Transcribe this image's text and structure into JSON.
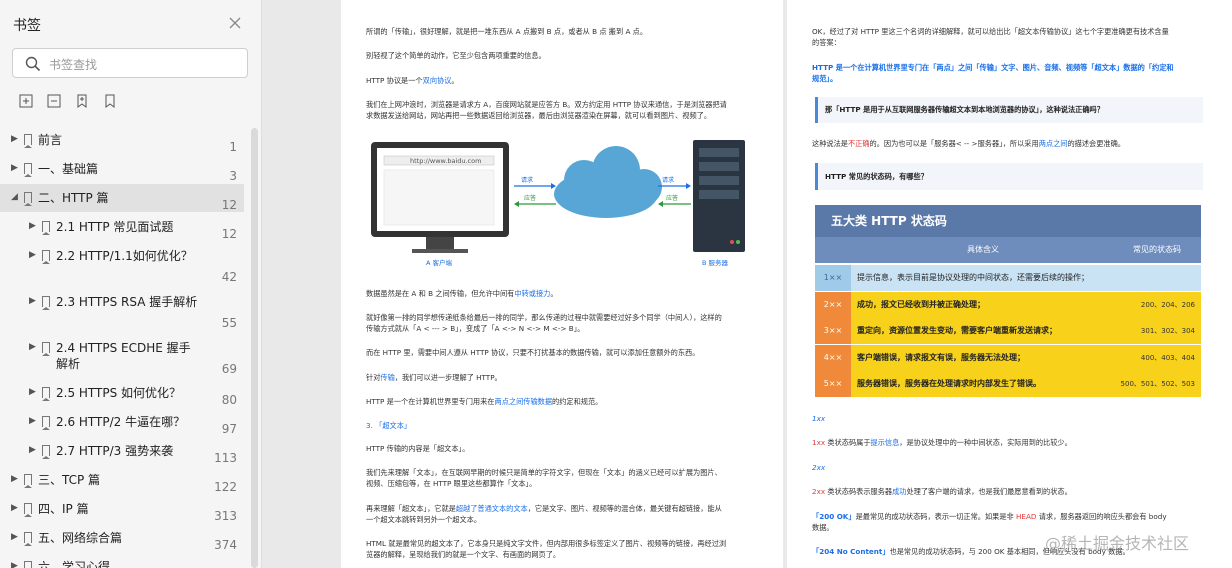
{
  "sidebar": {
    "title": "书签",
    "search_placeholder": "书签查找",
    "toolbar_icons": [
      "expand-all-icon",
      "collapse-all-icon",
      "add-bookmark-icon",
      "bookmark-icon"
    ],
    "items": [
      {
        "label": "前言",
        "page": "1",
        "level": 0,
        "active": false
      },
      {
        "label": "一、基础篇",
        "page": "3",
        "level": 0,
        "active": false
      },
      {
        "label": "二、HTTP 篇",
        "page": "12",
        "level": 0,
        "active": true,
        "expanded": true
      },
      {
        "label": "2.1 HTTP 常见面试题",
        "page": "12",
        "level": 1,
        "active": false
      },
      {
        "label": "2.2 HTTP/1.1如何优化？",
        "page": "42",
        "level": 1,
        "active": false
      },
      {
        "label": "2.3 HTTPS RSA 握手解析",
        "page": "55",
        "level": 1,
        "active": false
      },
      {
        "label": "2.4 HTTPS ECDHE 握手解析",
        "page": "69",
        "level": 1,
        "active": false
      },
      {
        "label": "2.5 HTTPS 如何优化？",
        "page": "80",
        "level": 1,
        "active": false
      },
      {
        "label": "2.6 HTTP/2 牛逼在哪？",
        "page": "97",
        "level": 1,
        "active": false
      },
      {
        "label": "2.7 HTTP/3 强势来袭",
        "page": "113",
        "level": 1,
        "active": false
      },
      {
        "label": "三、TCP 篇",
        "page": "122",
        "level": 0,
        "active": false
      },
      {
        "label": "四、IP 篇",
        "page": "313",
        "level": 0,
        "active": false
      },
      {
        "label": "五、网络综合篇",
        "page": "374",
        "level": 0,
        "active": false
      },
      {
        "label": "六、学习心得",
        "page": "",
        "level": 0,
        "active": false
      }
    ]
  },
  "page1": {
    "lines": [
      "所谓的「传输」，很好理解，就是把一堆东西从 A 点搬到 B 点，或者从 B 点 搬到 A 点。",
      "别轻视了这个简单的动作，它至少包含两项重要的信息。",
      "HTTP 协议是一个",
      "双向协议",
      "。",
      "我们在上网冲浪时，浏览器是请求方 A，百度网站就是应答方 B。双方约定用 HTTP 协议来通信，于是浏览器把请",
      "求数据发送给网站，网站再把一些数据返回给浏览器，最后由浏览器渲染在屏幕，就可以看到图片、视频了。",
      "数据虽然是在 A 和 B 之间传输，但允许中间有",
      "中转或接力",
      "。",
      "就好像第一排的同学想传递纸条给最后一排的同学，那么传递的过程中就需要经过好多个同学（中间人），这样的",
      "传输方式就从「A < --- > B」，变成了「A <-> N <-> M <-> B」。",
      "而在 HTTP 里，需要中间人遵从 HTTP 协议，只要不打扰基本的数据传输，就可以添加任意额外的东西。",
      "针对",
      "传输",
      "，我们可以进一步理解了 HTTP。",
      "HTTP 是一个在计算机世界里专门用来在",
      "两点之间传输数据",
      "的约定和规范。",
      "3. 「超文本」",
      "HTTP 传输的内容是「超文本」。",
      "我们先来理解「文本」，在互联网早期的时候只是简单的字符文字，但现在「文本」的涵义已经可以扩展为图片、",
      "视频、压缩包等，在 HTTP 眼里这些都算作「文本」。",
      "再来理解「超文本」，它就是",
      "超越了普通文本的文本",
      "，它是文字、图片、视频等的混合体，最关键有超链接，能从",
      "一个超文本跳转到另外一个超文本。",
      "HTML 就是最常见的超文本了，它本身只是纯文字文件，但内部用很多标签定义了图片、视频等的链接，再经过浏",
      "览器的解释，呈现给我们的就是一个文字、有画面的网页了。"
    ],
    "illustration": {
      "url": "http://www.baidu.com",
      "request": "请求",
      "response": "应答",
      "client": "A 客户端",
      "server": "B 服务器"
    }
  },
  "page2": {
    "lines": [
      "OK，经过了对 HTTP 里这三个名词的详细解释，就可以给出比「超文本传输协议」这七个字更准确更有技术含量",
      "的答案：",
      "HTTP 是一个在计算机世界里专门在「两点」之间「传输」文字、图片、音频、视频等「超文本」数据的「约定和",
      "规范」。",
      "那「HTTP 是用于从互联网服务器传输超文本到本地浏览器的协议」，这种说法正确吗？",
      "这种说法是",
      "不正确",
      "的。因为也可以是「服务器< -- >服务器」，所以采用",
      "两点之间",
      "的描述会更准确。",
      "HTTP 常见的状态码，有哪些？",
      "1xx",
      "1xx",
      " 类状态码属于",
      "提示信息",
      "，是协议处理中的一种中间状态，实际用到的比较少。",
      "2xx",
      "2xx",
      " 类状态码表示服务器",
      "成功",
      "处理了客户端的请求，也是我们最愿意看到的状态。",
      "「200 OK」",
      "是最常见的成功状态码，表示一切正常。如果是非",
      "HEAD",
      "请求，服务器返回的响应头都会有 body",
      "数据。",
      "「204 No Content」",
      "也是常见的成功状态码，与 200 OK 基本相同，但响应头没有 body 数据。"
    ],
    "status_table": {
      "title": "五大类 HTTP 状态码",
      "header_desc": "具体含义",
      "header_codes": "常见的状态码",
      "rows": [
        {
          "code": "1××",
          "desc": "提示信息，表示目前是协议处理的中间状态，还需要后续的操作；",
          "codes": "",
          "color": "#c9e3f5",
          "codecolor": "#9fcbe8"
        },
        {
          "code": "2××",
          "desc": "成功，报文已经收到并被正确处理；",
          "codes": "200、204、206",
          "color": "#f8d21a",
          "codecolor": "#f08a3a"
        },
        {
          "code": "3××",
          "desc": "重定向，资源位置发生变动，需要客户端重新发送请求；",
          "codes": "301、302、304",
          "color": "#f8d21a",
          "codecolor": "#f08a3a"
        },
        {
          "code": "4××",
          "desc": "客户端错误，请求报文有误，服务器无法处理；",
          "codes": "400、403、404",
          "color": "#f8d21a",
          "codecolor": "#f08a3a"
        },
        {
          "code": "5××",
          "desc": "服务器错误，服务器在处理请求时内部发生了错误。",
          "codes": "500、501、502、503",
          "color": "#f8d21a",
          "codecolor": "#f08a3a"
        }
      ]
    }
  },
  "watermark": "@稀土掘金技术社区"
}
